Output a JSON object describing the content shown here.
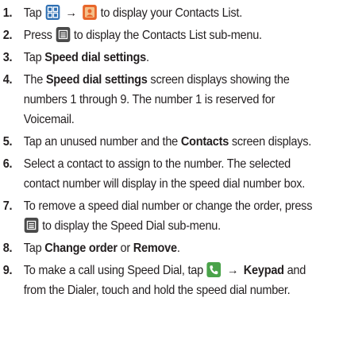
{
  "steps": [
    {
      "num": "1.",
      "parts": [
        "Tap",
        "to display your Contacts List."
      ]
    },
    {
      "num": "2.",
      "parts": [
        "Press",
        "to display the Contacts List sub-menu."
      ]
    },
    {
      "num": "3.",
      "parts": [
        "Tap",
        "Speed dial settings",
        "."
      ]
    },
    {
      "num": "4.",
      "parts": [
        "The",
        "Speed dial settings",
        "screen displays showing the",
        "numbers 1 through 9. The number 1 is reserved for",
        "Voicemail."
      ]
    },
    {
      "num": "5.",
      "parts": [
        "Tap an unused number and the",
        "Contacts",
        "screen displays."
      ]
    },
    {
      "num": "6.",
      "parts": [
        "Select a contact to assign to the number. The selected",
        "contact number will display in the speed dial number box."
      ]
    },
    {
      "num": "7.",
      "parts": [
        "To remove a speed dial number or change the order, press",
        "to display the Speed Dial sub-menu."
      ]
    },
    {
      "num": "8.",
      "parts": [
        "Tap",
        "Change order",
        "or",
        "Remove",
        "."
      ]
    },
    {
      "num": "9.",
      "parts": [
        "To make a call using Speed Dial, tap",
        "Keypad",
        "and",
        "from the Dialer, touch and hold the speed dial number."
      ]
    }
  ],
  "arrow": "→",
  "icons": {
    "apps": "apps-grid-icon",
    "contacts": "contacts-icon",
    "menu": "menu-key-icon",
    "phone": "phone-icon"
  },
  "colors": {
    "text": "#231f20",
    "apps_icon": "#2e6fb3",
    "contacts_icon": "#e8662a",
    "menu_icon": "#4a4a4a",
    "phone_icon": "#4aa34a"
  }
}
